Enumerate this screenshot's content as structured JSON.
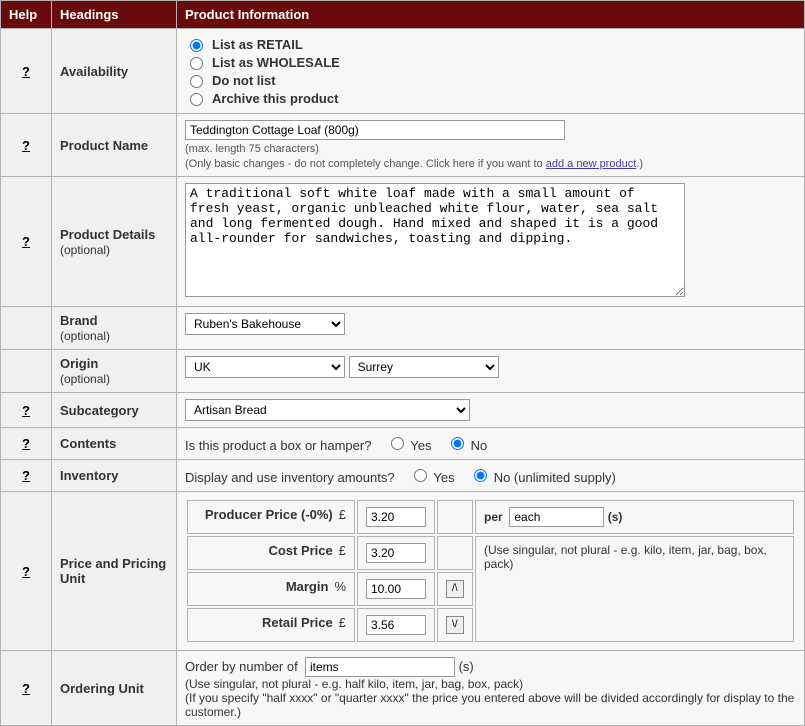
{
  "header": {
    "help": "Help",
    "headings": "Headings",
    "product_info": "Product Information"
  },
  "availability": {
    "heading": "Availability",
    "options": {
      "retail": "List as RETAIL",
      "wholesale": "List as WHOLESALE",
      "donot": "Do not list",
      "archive": "Archive this product"
    },
    "selected": "retail"
  },
  "product_name": {
    "heading": "Product Name",
    "value": "Teddington Cottage Loaf (800g)",
    "hint_max": "(max. length 75 characters)",
    "hint_basic": "(Only basic changes - do not completely change. Click here if you want to ",
    "hint_link": "add a new product",
    "hint_close": ".)"
  },
  "product_details": {
    "heading": "Product Details",
    "optional": "(optional)",
    "value": "A traditional soft white loaf made with a small amount of fresh yeast, organic unbleached white flour, water, sea salt and long fermented dough. Hand mixed and shaped it is a good all-rounder for sandwiches, toasting and dipping."
  },
  "brand": {
    "heading": "Brand",
    "optional": "(optional)",
    "value": "Ruben's Bakehouse"
  },
  "origin": {
    "heading": "Origin",
    "optional": "(optional)",
    "country": "UK",
    "region": "Surrey"
  },
  "subcategory": {
    "heading": "Subcategory",
    "value": "Artisan Bread"
  },
  "contents": {
    "heading": "Contents",
    "question": "Is this product a box or hamper?",
    "yes": "Yes",
    "no": "No",
    "selected": "no"
  },
  "inventory": {
    "heading": "Inventory",
    "question": "Display and use inventory amounts?",
    "yes": "Yes",
    "no": "No (unlimited supply)",
    "selected": "no"
  },
  "pricing": {
    "heading": "Price and Pricing Unit",
    "producer_price_label": "Producer Price (-0%)",
    "producer_price": "3.20",
    "cost_price_label": "Cost Price",
    "cost_price": "3.20",
    "margin_label": "Margin",
    "margin": "10.00",
    "retail_price_label": "Retail Price",
    "retail_price": "3.56",
    "currency": "£",
    "percent": "%",
    "per_label": "per",
    "per_unit": "each",
    "per_suffix": "(s)",
    "per_hint": "(Use singular, not plural - e.g. kilo, item, jar, bag, box, pack)",
    "step_up": "/\\",
    "step_down": "\\/"
  },
  "ordering": {
    "heading": "Ordering Unit",
    "order_by": "Order by number of",
    "unit": "items",
    "suffix": "(s)",
    "hint1": "(Use singular, not plural - e.g. half kilo, item, jar, bag, box, pack)",
    "hint2": "(If you specify \"half xxxx\" or \"quarter xxxx\" the price you entered above will be divided accordingly for display to the customer.)"
  },
  "help_icon": "?"
}
